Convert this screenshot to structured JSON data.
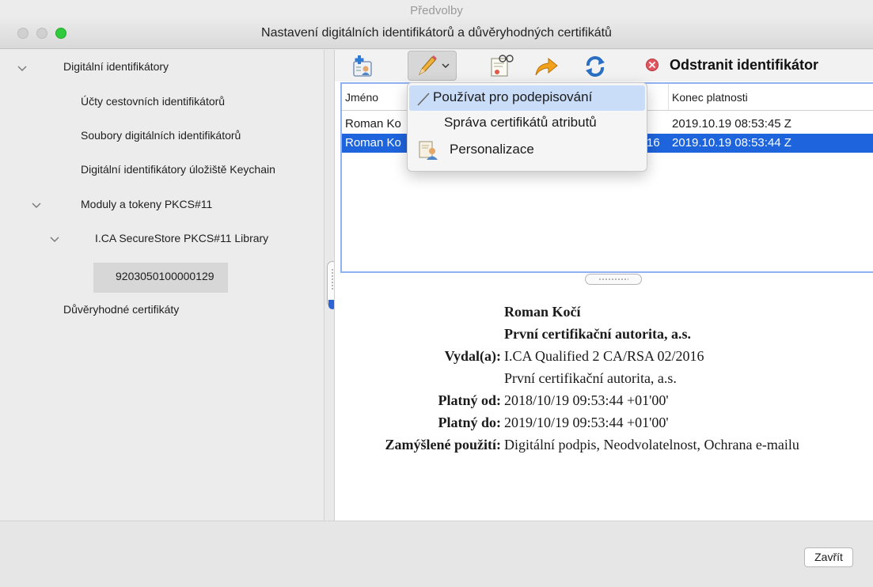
{
  "window": {
    "background_title": "Předvolby",
    "title": "Nastavení digitálních identifikátorů a důvěryhodných certifikátů"
  },
  "tree": {
    "digital_ids": "Digitální identifikátory",
    "roaming_accounts": "Účty cestovních identifikátorů",
    "id_files": "Soubory digitálních identifikátorů",
    "keychain": "Digitální identifikátory úložiště Keychain",
    "pkcs_modules": "Moduly a tokeny PKCS#11",
    "library": "I.CA SecureStore PKCS#11 Library",
    "serial": "9203050100000129",
    "trusted_certs": "Důvěryhodné certifikáty"
  },
  "toolbar": {
    "remove_label": "Odstranit identifikátor"
  },
  "table": {
    "columns": [
      "Jméno",
      "Konec platnosti"
    ],
    "rows": [
      {
        "name": "Roman Ko",
        "hidden_frag": "",
        "expires": "2019.10.19 08:53:45 Z"
      },
      {
        "name": "Roman Ko",
        "hidden_frag": "16",
        "expires": "2019.10.19 08:53:44 Z"
      }
    ]
  },
  "menu": {
    "items": [
      "Používat pro podepisování",
      "Správa certifikátů atributů",
      "Personalizace"
    ]
  },
  "details": {
    "name": "Roman Kočí",
    "org": "První certifikační autorita, a.s.",
    "issued_by_label": "Vydal(a):",
    "issued_by": "I.CA Qualified 2 CA/RSA 02/2016",
    "issued_by_org": "První certifikační autorita, a.s.",
    "valid_from_label": "Platný od:",
    "valid_from": "2018/10/19 09:53:44 +01'00'",
    "valid_to_label": "Platný do:",
    "valid_to": "2019/10/19 09:53:44 +01'00'",
    "usage_label": "Zamýšlené použití:",
    "usage": "Digitální podpis, Neodvolatelnost, Ochrana e-mailu"
  },
  "footer": {
    "close_label": "Zavřít"
  },
  "colors": {
    "selection": "#1e64dc",
    "menu_highlight": "#c9dcf8",
    "table_focus": "#8fb1f2"
  }
}
